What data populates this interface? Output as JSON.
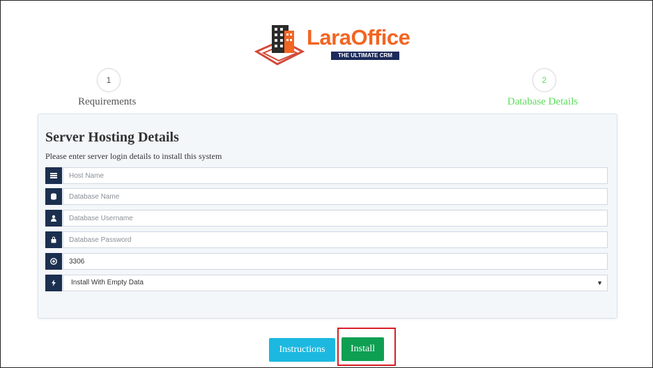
{
  "brand": {
    "name": "LaraOffice",
    "tagline": "THE ULTIMATE CRM",
    "accent_color": "#f26522"
  },
  "steps": [
    {
      "number": "1",
      "label": "Requirements",
      "state": "inactive"
    },
    {
      "number": "2",
      "label": "Database Details",
      "state": "active",
      "color": "#5adc5a"
    }
  ],
  "panel": {
    "title": "Server Hosting Details",
    "subtitle": "Please enter server login details to install this system",
    "fields": [
      {
        "icon": "list-icon",
        "placeholder": "Host Name",
        "value": ""
      },
      {
        "icon": "database-icon",
        "placeholder": "Database Name",
        "value": ""
      },
      {
        "icon": "user-icon",
        "placeholder": "Database Username",
        "value": ""
      },
      {
        "icon": "lock-icon",
        "placeholder": "Database Password",
        "value": ""
      },
      {
        "icon": "target-icon",
        "placeholder": "",
        "value": "3306"
      }
    ],
    "data_select": {
      "icon": "bolt-icon",
      "selected": "Install With Empty Data"
    }
  },
  "buttons": {
    "instructions": "Instructions",
    "install": "Install"
  },
  "colors": {
    "icon_bg": "#1b2f4f",
    "instructions_bg": "#1cb8e0",
    "install_bg": "#0e9f52",
    "highlight_border": "#d71f26"
  }
}
